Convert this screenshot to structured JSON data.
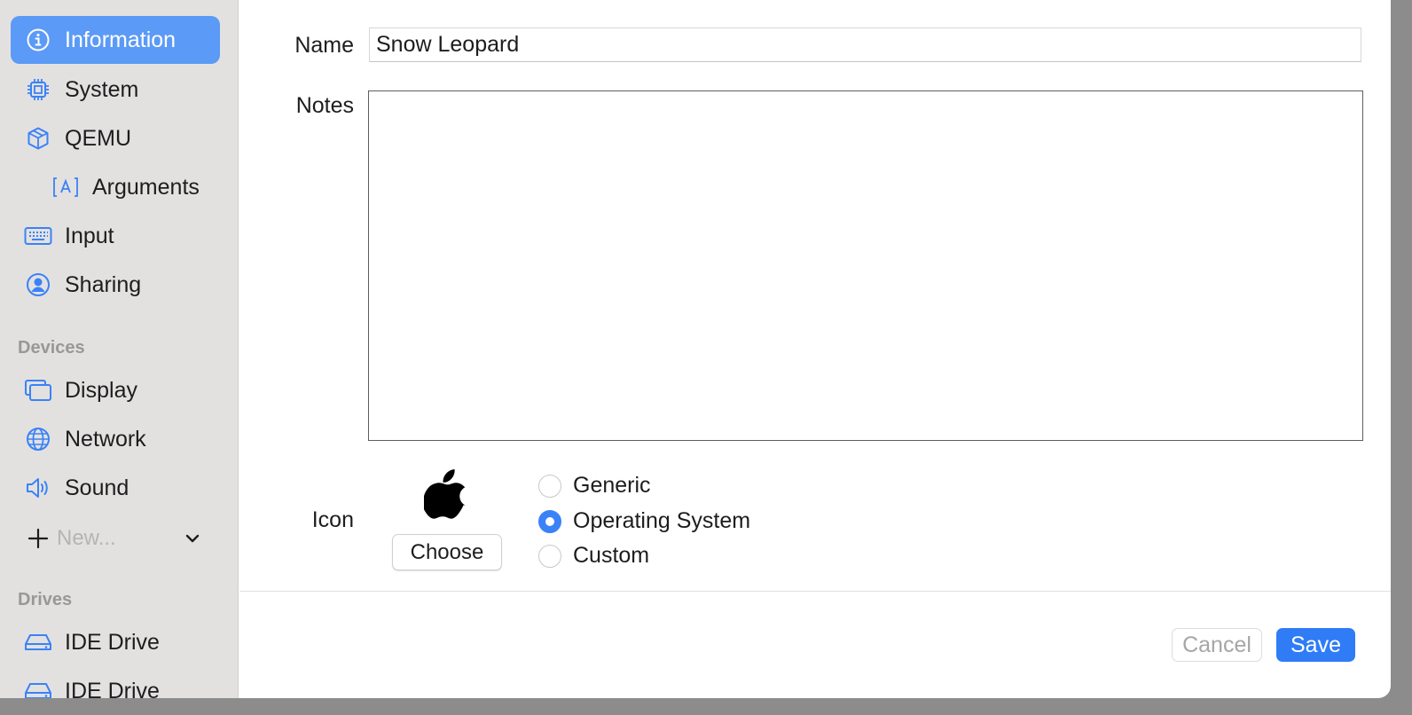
{
  "colors": {
    "accent": "#3a82f7",
    "sidebar_selected": "#5b9af6",
    "sidebar_bg": "#e3e1e0"
  },
  "sidebar": {
    "items": [
      {
        "label": "Information",
        "icon": "info-circle-icon",
        "selected": true
      },
      {
        "label": "System",
        "icon": "cpu-chip-icon"
      },
      {
        "label": "QEMU",
        "icon": "cube-icon"
      },
      {
        "label": "Arguments",
        "icon": "text-box-a-icon"
      },
      {
        "label": "Input",
        "icon": "keyboard-icon"
      },
      {
        "label": "Sharing",
        "icon": "person-circle-icon"
      }
    ],
    "devices_header": "Devices",
    "devices": [
      {
        "label": "Display",
        "icon": "display-windows-icon"
      },
      {
        "label": "Network",
        "icon": "globe-network-icon"
      },
      {
        "label": "Sound",
        "icon": "speaker-icon"
      }
    ],
    "new_label": "New...",
    "drives_header": "Drives",
    "drives": [
      {
        "label": "IDE Drive",
        "icon": "drive-icon"
      },
      {
        "label": "IDE Drive",
        "icon": "drive-icon"
      }
    ]
  },
  "form": {
    "name_label": "Name",
    "name_value": "Snow Leopard",
    "notes_label": "Notes",
    "notes_value": "",
    "icon_label": "Icon",
    "icon_preview": "apple-logo-icon",
    "choose_label": "Choose",
    "icon_options": [
      {
        "label": "Generic",
        "checked": false
      },
      {
        "label": "Operating System",
        "checked": true
      },
      {
        "label": "Custom",
        "checked": false
      }
    ]
  },
  "footer": {
    "cancel_label": "Cancel",
    "save_label": "Save"
  }
}
